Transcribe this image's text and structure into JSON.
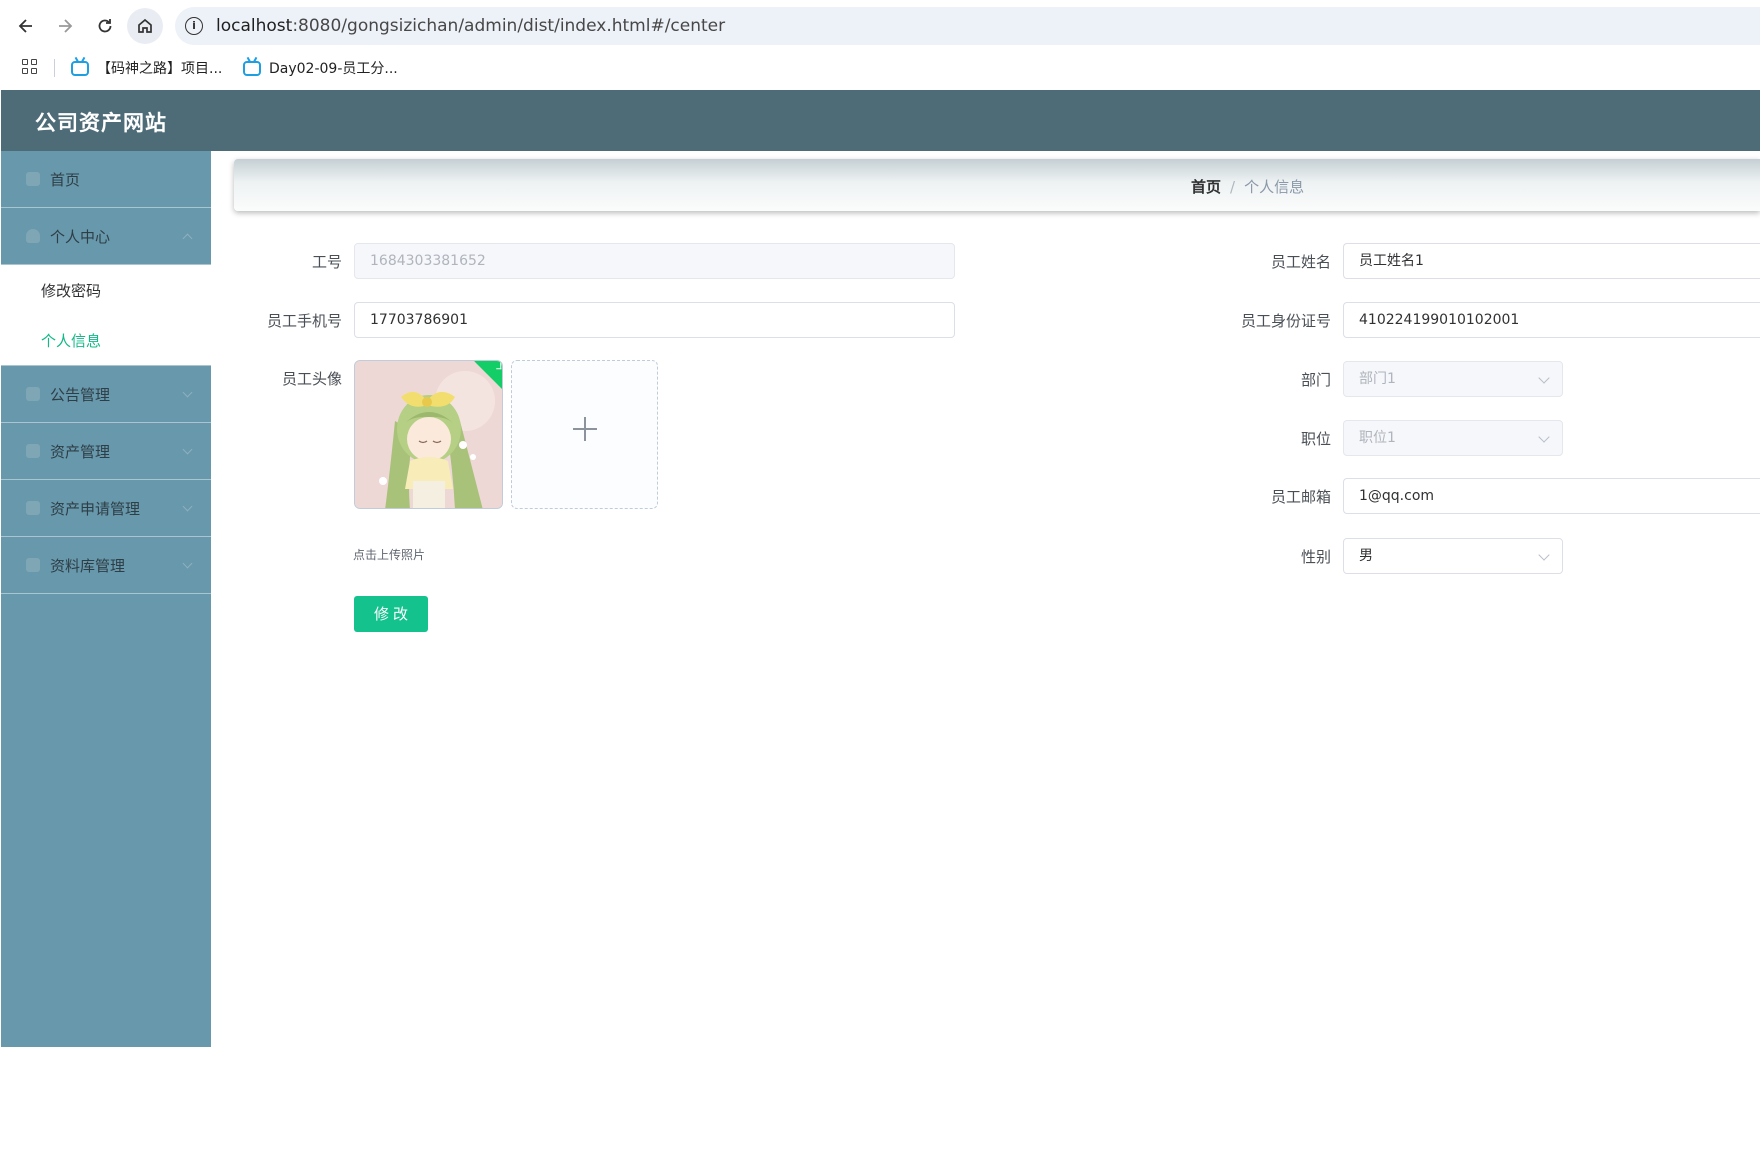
{
  "browser": {
    "url_host": "localhost",
    "url_rest": ":8080/gongsizichan/admin/dist/index.html#/center",
    "bookmarks": [
      {
        "label": "【码神之路】项目..."
      },
      {
        "label": "Day02-09-员工分..."
      }
    ]
  },
  "header": {
    "title": "公司资产网站"
  },
  "sidebar": {
    "items": [
      {
        "label": "首页",
        "icon": "home-icon"
      },
      {
        "label": "个人中心",
        "icon": "user-icon"
      },
      {
        "label": "公告管理",
        "icon": "notice-icon"
      },
      {
        "label": "资产管理",
        "icon": "asset-icon"
      },
      {
        "label": "资产申请管理",
        "icon": "apply-icon"
      },
      {
        "label": "资料库管理",
        "icon": "library-icon"
      }
    ],
    "submenu": [
      {
        "label": "修改密码"
      },
      {
        "label": "个人信息"
      }
    ]
  },
  "breadcrumb": {
    "home": "首页",
    "separator": "/",
    "current": "个人信息"
  },
  "form": {
    "job_no": {
      "label": "工号",
      "value": "1684303381652"
    },
    "phone": {
      "label": "员工手机号",
      "value": "17703786901"
    },
    "avatar": {
      "label": "员工头像",
      "tip": "点击上传照片"
    },
    "name": {
      "label": "员工姓名",
      "value": "员工姓名1"
    },
    "id_card": {
      "label": "员工身份证号",
      "value": "410224199010102001"
    },
    "department": {
      "label": "部门",
      "value": "部门1"
    },
    "position": {
      "label": "职位",
      "value": "职位1"
    },
    "email": {
      "label": "员工邮箱",
      "value": "1@qq.com"
    },
    "gender": {
      "label": "性别",
      "value": "男"
    },
    "submit_label": "修改"
  },
  "colors": {
    "header_bg": "#4e6c78",
    "sidebar_bg": "#6898ab",
    "accent": "#13c28d"
  }
}
